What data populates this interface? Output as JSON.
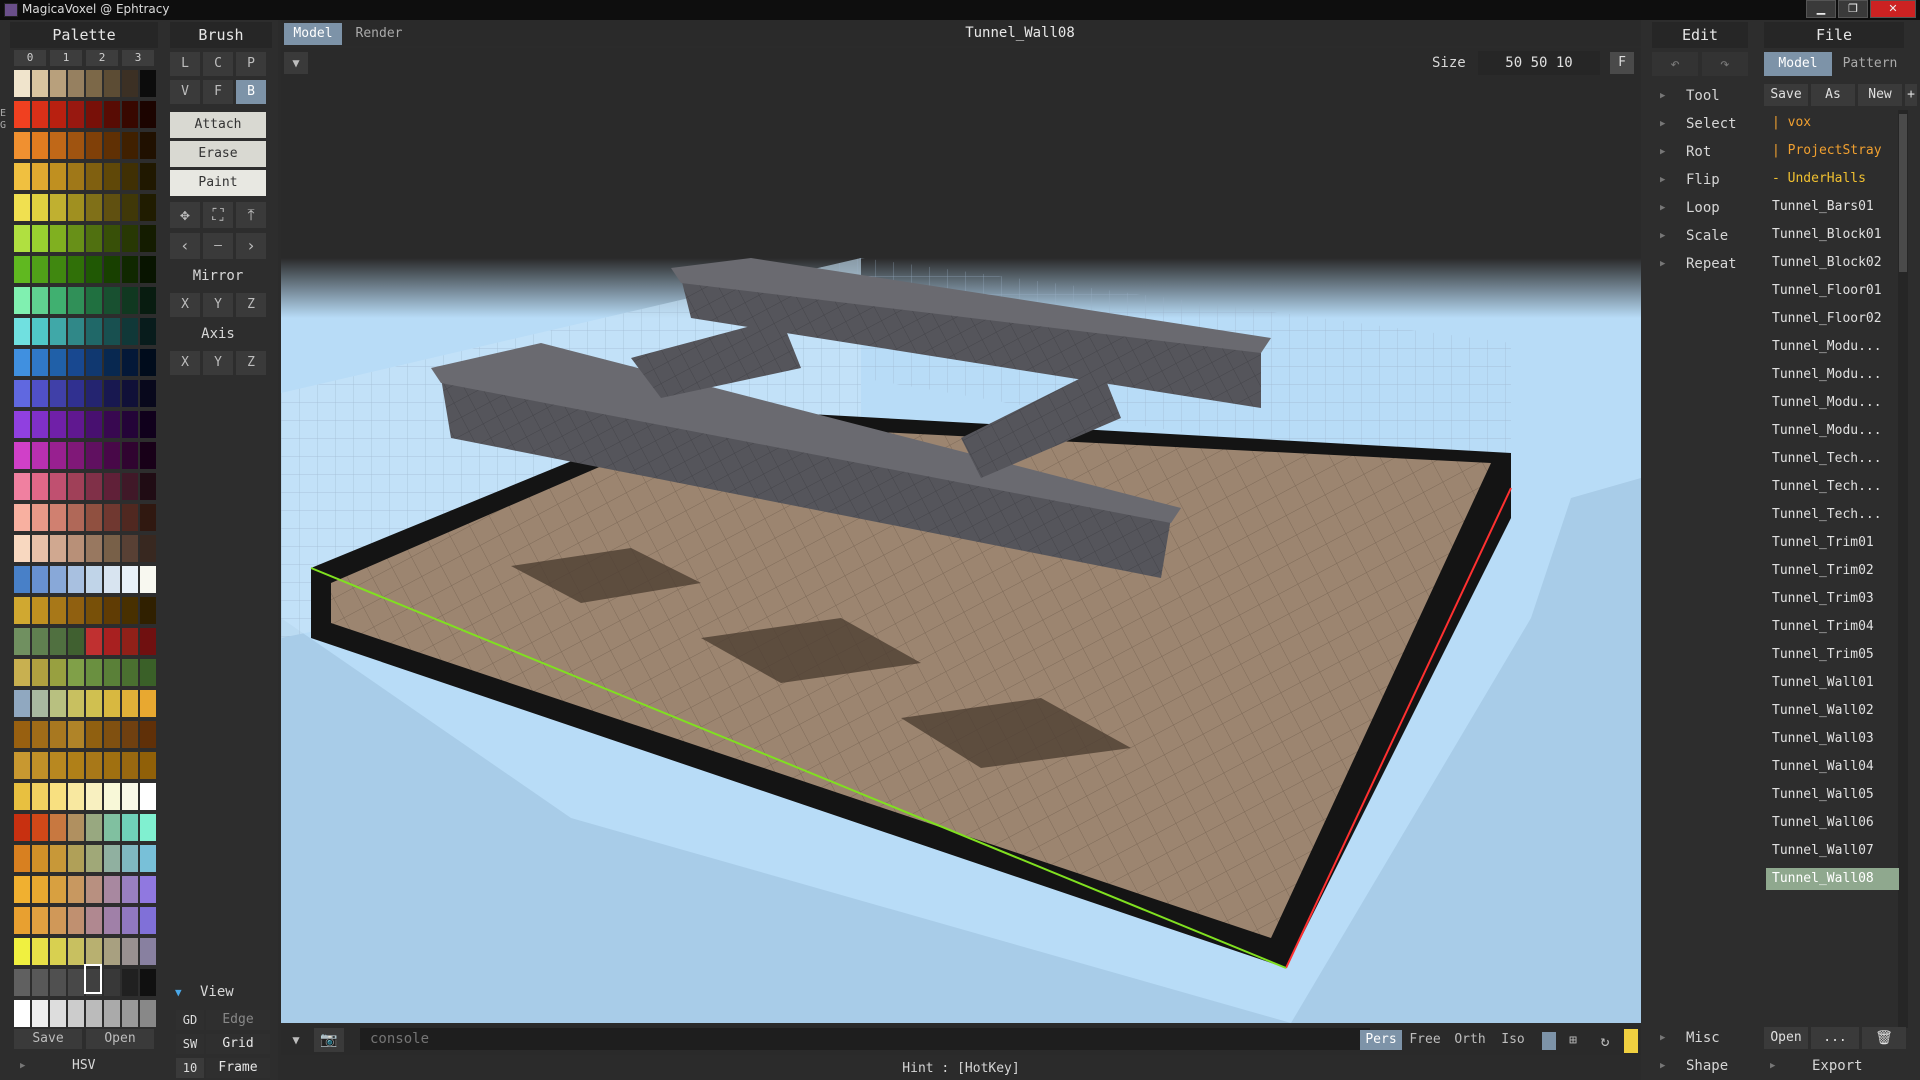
{
  "window": {
    "title": "MagicaVoxel @ Ephtracy",
    "minimize": "▁",
    "restore": "❐",
    "close": "✕"
  },
  "palette": {
    "title": "Palette",
    "columns": [
      "0",
      "1",
      "2",
      "3"
    ],
    "save": "Save",
    "open": "Open",
    "hsv": "HSV",
    "side_letters": [
      "E",
      "G"
    ],
    "colors": [
      [
        "#f0e4cc",
        "#d8c4a0",
        "#b8a07c",
        "#968060",
        "#7c6848",
        "#5c4c34",
        "#3c3024",
        "#0c0c0c"
      ],
      [
        "#f04020",
        "#d83018",
        "#b82010",
        "#981810",
        "#781008",
        "#580c04",
        "#380800",
        "#1c0400"
      ],
      [
        "#f09030",
        "#e07c20",
        "#c06818",
        "#a05410",
        "#804008",
        "#603004",
        "#402000",
        "#201000"
      ],
      [
        "#f0c040",
        "#e0a830",
        "#c09020",
        "#a07818",
        "#806010",
        "#604808",
        "#403004",
        "#201800"
      ],
      [
        "#f0e050",
        "#e0d040",
        "#c0b030",
        "#a09020",
        "#807018",
        "#605010",
        "#403808",
        "#201c00"
      ],
      [
        "#b0e040",
        "#98d030",
        "#80b020",
        "#689018",
        "#507010",
        "#385008",
        "#283804",
        "#141c00"
      ],
      [
        "#60b820",
        "#50a018",
        "#408810",
        "#307008",
        "#205804",
        "#184000",
        "#102800",
        "#081400"
      ],
      [
        "#80f0b0",
        "#60d090",
        "#40b070",
        "#309058",
        "#207040",
        "#185030",
        "#103820",
        "#081c10"
      ],
      [
        "#70e0e0",
        "#50c8c8",
        "#40a8a8",
        "#308888",
        "#206868",
        "#185050",
        "#103838",
        "#081c1c"
      ],
      [
        "#4090e0",
        "#3078c8",
        "#2060a8",
        "#184890",
        "#103870",
        "#082850",
        "#041838",
        "#000c1c"
      ],
      [
        "#6068e0",
        "#5050c8",
        "#4040a8",
        "#303090",
        "#242470",
        "#181850",
        "#101038",
        "#08081c"
      ],
      [
        "#9040e0",
        "#8030c8",
        "#7020a8",
        "#601890",
        "#481070",
        "#380850",
        "#240438",
        "#10001c"
      ],
      [
        "#d040c8",
        "#b830b0",
        "#982090",
        "#801878",
        "#601060",
        "#480848",
        "#300430",
        "#180018"
      ],
      [
        "#f080a0",
        "#e06888",
        "#c05070",
        "#a04058",
        "#803048",
        "#602038",
        "#401828",
        "#200c14"
      ],
      [
        "#f8b0a0",
        "#e89888",
        "#d08070",
        "#b06858",
        "#905040",
        "#703830",
        "#502820",
        "#301810"
      ],
      [
        "#f8d8c0",
        "#e8c0a8",
        "#d0a890",
        "#b89078",
        "#987860",
        "#786048",
        "#584034",
        "#382820"
      ],
      [
        "#4880c8",
        "#6890d0",
        "#88a8d8",
        "#a8c0e0",
        "#c0d4e8",
        "#d8e4f0",
        "#e8f0f8",
        "#f8f8f0"
      ],
      [
        "#d0a830",
        "#c09020",
        "#a87818",
        "#906010",
        "#785008",
        "#603c04",
        "#483000",
        "#302000"
      ],
      [
        "#709060",
        "#608050",
        "#507040",
        "#406030",
        "#c03030",
        "#a82020",
        "#902018",
        "#701010"
      ],
      [
        "#c8b050",
        "#b0a040",
        "#98a040",
        "#80a048",
        "#6a9040",
        "#5a8038",
        "#4a7030",
        "#3a6028"
      ],
      [
        "#90a8c0",
        "#a8b8a0",
        "#b8c080",
        "#c8c060",
        "#d0c050",
        "#d8b840",
        "#e0b038",
        "#e8a830"
      ],
      [
        "#986010",
        "#a06c18",
        "#a87820",
        "#b08428",
        "#906010",
        "#805010",
        "#704010",
        "#603008"
      ],
      [
        "#c89830",
        "#c09028",
        "#b88820",
        "#b08018",
        "#a87818",
        "#a07010",
        "#986810",
        "#906008"
      ],
      [
        "#e8c040",
        "#f0d060",
        "#f8e080",
        "#f8e8a0",
        "#f8f0c0",
        "#f8f8d8",
        "#f8f8e8",
        "#ffffff"
      ],
      [
        "#c83010",
        "#d04818",
        "#c87840",
        "#b09060",
        "#98a880",
        "#80c0a0",
        "#70d0b8",
        "#80f0d0"
      ],
      [
        "#d88020",
        "#d09028",
        "#c89838",
        "#b0a058",
        "#a0a878",
        "#90b0a0",
        "#80b8c0",
        "#78c0d8"
      ],
      [
        "#f0b030",
        "#e8a830",
        "#d8a040",
        "#c89860",
        "#b89080",
        "#a888a0",
        "#9880c0",
        "#9078e0"
      ],
      [
        "#e8a030",
        "#e0a040",
        "#d09858",
        "#c09070",
        "#b08890",
        "#a080a8",
        "#9078c0",
        "#8070d8"
      ],
      [
        "#f0f040",
        "#e8e048",
        "#d8d050",
        "#c8c060",
        "#b8b070",
        "#a8a080",
        "#989090",
        "#8880a0"
      ],
      [
        "#606060",
        "#585858",
        "#505050",
        "#484848",
        "#404040",
        "#383838",
        "#202020",
        "#101010"
      ],
      [
        "#ffffff",
        "#eeeeee",
        "#dddddd",
        "#cccccc",
        "#bbbbbb",
        "#aaaaaa",
        "#999999",
        "#888888"
      ]
    ]
  },
  "brush": {
    "title": "Brush",
    "shape_row1": [
      "L",
      "C",
      "P"
    ],
    "shape_row2": [
      "V",
      "F",
      "B"
    ],
    "modes": [
      "Attach",
      "Erase",
      "Paint"
    ],
    "tool_icons": [
      "move-icon",
      "select-region-icon",
      "raise-icon"
    ],
    "nav_icons": [
      "‹",
      "—",
      "›"
    ],
    "mirror_title": "Mirror",
    "mirror": [
      "X",
      "Y",
      "Z"
    ],
    "axis_title": "Axis",
    "axis": [
      "X",
      "Y",
      "Z"
    ],
    "view_label": "View",
    "view_rows": [
      {
        "key": "GD",
        "value": "Edge"
      },
      {
        "key": "SW",
        "value": "Grid"
      },
      {
        "key": "10",
        "value": "Frame"
      }
    ]
  },
  "toolbar": {
    "tabs": [
      "Model",
      "Render"
    ],
    "document_title": "Tunnel_Wall08",
    "size_label": "Size",
    "size_value": "50 50 10",
    "f_label": "F"
  },
  "bottom": {
    "console_placeholder": "console",
    "projections": [
      "Pers",
      "Free",
      "Orth",
      "Iso"
    ],
    "hint": "Hint : [HotKey]"
  },
  "edit": {
    "title": "Edit",
    "items": [
      "Tool",
      "Select",
      "Rot",
      "Flip",
      "Loop",
      "Scale",
      "Repeat"
    ],
    "bottom_items": [
      "Misc",
      "Shape"
    ]
  },
  "file": {
    "title": "File",
    "tabs": [
      "Model",
      "Pattern"
    ],
    "actions": [
      "Save",
      "As",
      "New",
      "+"
    ],
    "folders": [
      {
        "label": "| vox",
        "color": "#f0a030"
      },
      {
        "label": "| ProjectStray",
        "color": "#f0a030"
      },
      {
        "label": "- UnderHalls",
        "color": "#f0c030"
      }
    ],
    "files": [
      "Tunnel_Bars01",
      "Tunnel_Block01",
      "Tunnel_Block02",
      "Tunnel_Floor01",
      "Tunnel_Floor02",
      "Tunnel_Modu...",
      "Tunnel_Modu...",
      "Tunnel_Modu...",
      "Tunnel_Modu...",
      "Tunnel_Tech...",
      "Tunnel_Tech...",
      "Tunnel_Tech...",
      "Tunnel_Trim01",
      "Tunnel_Trim02",
      "Tunnel_Trim03",
      "Tunnel_Trim04",
      "Tunnel_Trim05",
      "Tunnel_Wall01",
      "Tunnel_Wall02",
      "Tunnel_Wall03",
      "Tunnel_Wall04",
      "Tunnel_Wall05",
      "Tunnel_Wall06",
      "Tunnel_Wall07",
      "Tunnel_Wall08"
    ],
    "selected": "Tunnel_Wall08",
    "open": "Open",
    "more": "...",
    "export": "Export"
  },
  "colors": {
    "accent": "#7d93a8",
    "selected_file": "#8fa88e",
    "viewport_bg": "#b8dcf7",
    "x_axis": "#ff3030",
    "y_axis": "#80e020"
  }
}
